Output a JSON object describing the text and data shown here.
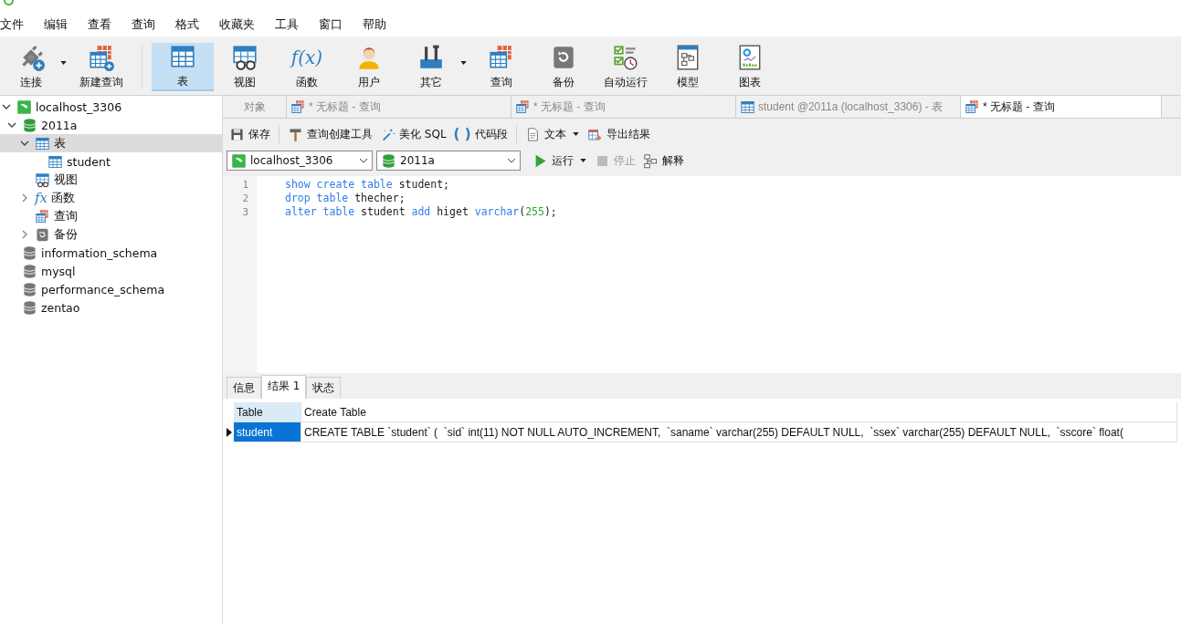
{
  "menu": [
    "文件",
    "编辑",
    "查看",
    "查询",
    "格式",
    "收藏夹",
    "工具",
    "窗口",
    "帮助"
  ],
  "toolbar": [
    {
      "label": "连接",
      "kind": "plug",
      "dropdown": true,
      "selected": false
    },
    {
      "label": "新建查询",
      "kind": "newquery",
      "dropdown": false,
      "selected": false
    },
    {
      "kind": "separator"
    },
    {
      "label": "表",
      "kind": "table",
      "dropdown": false,
      "selected": true
    },
    {
      "label": "视图",
      "kind": "view",
      "dropdown": false,
      "selected": false
    },
    {
      "label": "函数",
      "kind": "function",
      "glyph": "f(x)",
      "dropdown": false,
      "selected": false
    },
    {
      "label": "用户",
      "kind": "user",
      "dropdown": false,
      "selected": false
    },
    {
      "label": "其它",
      "kind": "tools",
      "dropdown": true,
      "selected": false
    },
    {
      "label": "查询",
      "kind": "query",
      "dropdown": false,
      "selected": false
    },
    {
      "label": "备份",
      "kind": "backup",
      "dropdown": false,
      "selected": false
    },
    {
      "label": "自动运行",
      "kind": "autorun",
      "dropdown": false,
      "selected": false
    },
    {
      "label": "模型",
      "kind": "model",
      "dropdown": false,
      "selected": false
    },
    {
      "label": "图表",
      "kind": "chart",
      "dropdown": false,
      "selected": false
    }
  ],
  "sidebar": {
    "items": [
      {
        "label": "localhost_3306",
        "kind": "connection",
        "expanded": true,
        "selected": false,
        "children": [
          {
            "label": "2011a",
            "kind": "database",
            "open": true,
            "expanded": true,
            "selected": false,
            "children": [
              {
                "label": "表",
                "kind": "table",
                "expanded": true,
                "selected": true,
                "children": [
                  {
                    "label": "student",
                    "kind": "table",
                    "selected": false
                  }
                ]
              },
              {
                "label": "视图",
                "kind": "view",
                "selected": false
              },
              {
                "label": "函数",
                "kind": "function",
                "glyph": "fx",
                "expanded": false,
                "selected": false
              },
              {
                "label": "查询",
                "kind": "query",
                "selected": false
              },
              {
                "label": "备份",
                "kind": "backup",
                "expanded": false,
                "selected": false
              }
            ]
          },
          {
            "label": "information_schema",
            "kind": "database",
            "open": false,
            "selected": false
          },
          {
            "label": "mysql",
            "kind": "database",
            "open": false,
            "selected": false
          },
          {
            "label": "performance_schema",
            "kind": "database",
            "open": false,
            "selected": false
          },
          {
            "label": "zentao",
            "kind": "database",
            "open": false,
            "selected": false
          }
        ]
      }
    ]
  },
  "tabs": [
    {
      "label": "对象",
      "kind": "objects",
      "selected": false
    },
    {
      "label": "* 无标题 - 查询",
      "kind": "query",
      "selected": false
    },
    {
      "label": "* 无标题 - 查询",
      "kind": "query",
      "selected": false
    },
    {
      "label": "student @2011a (localhost_3306) - 表",
      "kind": "table",
      "selected": false
    },
    {
      "label": "* 无标题 - 查询",
      "kind": "query",
      "selected": true
    }
  ],
  "query_toolbar": [
    {
      "label": "保存",
      "kind": "save",
      "dropdown": false
    },
    {
      "kind": "separator"
    },
    {
      "label": "查询创建工具",
      "kind": "hammer",
      "dropdown": false
    },
    {
      "label": "美化 SQL",
      "kind": "wand",
      "dropdown": false
    },
    {
      "label": "代码段",
      "kind": "snippet",
      "glyph": "( )",
      "dropdown": false
    },
    {
      "kind": "separator"
    },
    {
      "label": "文本",
      "kind": "document",
      "dropdown": true
    },
    {
      "label": "导出结果",
      "kind": "export",
      "dropdown": false
    }
  ],
  "run_bar": {
    "connection": "localhost_3306",
    "database": "2011a",
    "actions": [
      {
        "label": "运行",
        "kind": "play",
        "dropdown": true,
        "disabled": false
      },
      {
        "label": "停止",
        "kind": "stop",
        "dropdown": false,
        "disabled": true
      },
      {
        "label": "解释",
        "kind": "explain",
        "dropdown": false,
        "disabled": false
      }
    ]
  },
  "editor": {
    "lines": [
      {
        "number": "1",
        "tokens": [
          {
            "text": "show create table",
            "kind": "keyword"
          },
          {
            "text": " student;",
            "kind": "plain"
          }
        ]
      },
      {
        "number": "2",
        "tokens": [
          {
            "text": "drop table",
            "kind": "keyword"
          },
          {
            "text": " thecher;",
            "kind": "plain"
          }
        ]
      },
      {
        "number": "3",
        "tokens": [
          {
            "text": "alter table",
            "kind": "keyword"
          },
          {
            "text": " student ",
            "kind": "plain"
          },
          {
            "text": "add",
            "kind": "keyword"
          },
          {
            "text": " higet ",
            "kind": "plain"
          },
          {
            "text": "varchar",
            "kind": "keyword"
          },
          {
            "text": "(",
            "kind": "plain"
          },
          {
            "text": "255",
            "kind": "number"
          },
          {
            "text": ");",
            "kind": "plain"
          }
        ]
      }
    ]
  },
  "result_tabs": [
    {
      "label": "信息",
      "selected": false
    },
    {
      "label": "结果 1",
      "selected": true
    },
    {
      "label": "状态",
      "selected": false
    }
  ],
  "table": {
    "columns": [
      "Table",
      "Create Table"
    ],
    "rows": [
      {
        "selected": true,
        "cells": [
          "student",
          "CREATE TABLE `student` (  `sid` int(11) NOT NULL AUTO_INCREMENT,  `saname` varchar(255) DEFAULT NULL,  `ssex` varchar(255) DEFAULT NULL,  `sscore` float("
        ]
      }
    ]
  }
}
